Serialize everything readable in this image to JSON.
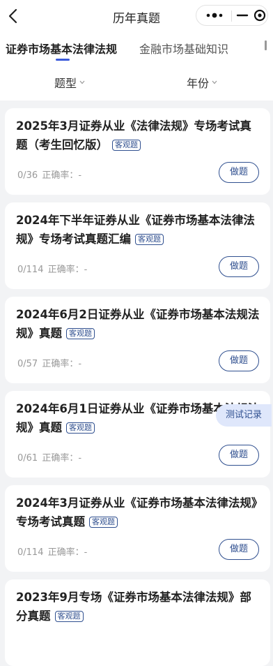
{
  "nav": {
    "title": "历年真题"
  },
  "tabs": [
    {
      "label": "证券市场基本法律法规",
      "active": true
    },
    {
      "label": "金融市场基础知识",
      "active": false
    }
  ],
  "filters": {
    "type_label": "题型",
    "year_label": "年份"
  },
  "cards": [
    {
      "title": "2025年3月证券从业《法律法规》专场考试真题（考生回忆版）",
      "tag": "客观题",
      "progress": "0/36",
      "accuracy_label": "正确率：-",
      "button": "做题"
    },
    {
      "title": "2024年下半年证券从业《证券市场基本法律法规》专场考试真题汇编",
      "tag": "客观题",
      "progress": "0/114",
      "accuracy_label": "正确率：-",
      "button": "做题"
    },
    {
      "title": "2024年6月2日证券从业《证券市场基本法规法规》真题",
      "tag": "客观题",
      "progress": "0/57",
      "accuracy_label": "正确率：-",
      "button": "做题"
    },
    {
      "title": "2024年6月1日证券从业《证券市场基本法规法规》真题",
      "tag": "客观题",
      "progress": "0/61",
      "accuracy_label": "正确率：-",
      "button": "做题"
    },
    {
      "title": "2024年3月证券从业《证券市场基本法律法规》专场考试真题",
      "tag": "客观题",
      "progress": "0/114",
      "accuracy_label": "正确率：-",
      "button": "做题"
    },
    {
      "title": "2023年9月专场《证券市场基本法律法规》部分真题",
      "tag": "客观题",
      "progress": "",
      "accuracy_label": "",
      "button": ""
    }
  ],
  "float_button": "测试记录",
  "colors": {
    "accent": "#2f4f8f",
    "tab_underline": "#3b5bdb",
    "background": "#f2f3f5"
  }
}
